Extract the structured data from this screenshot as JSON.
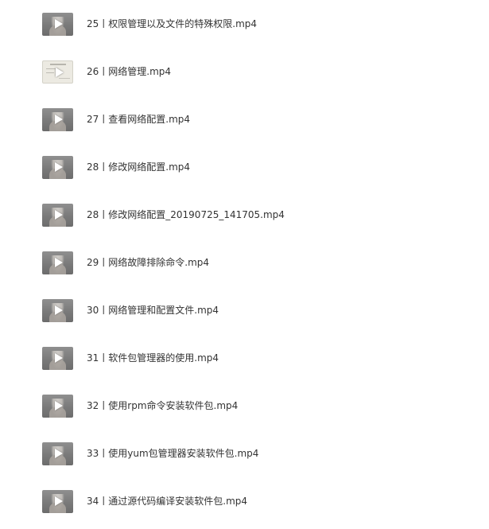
{
  "file_list": {
    "items": [
      {
        "name": "25丨权限管理以及文件的特殊权限.mp4",
        "thumbnail": "video-thumbnail-person"
      },
      {
        "name": "26丨网络管理.mp4",
        "thumbnail": "video-thumbnail-screen"
      },
      {
        "name": "27丨查看网络配置.mp4",
        "thumbnail": "video-thumbnail-person"
      },
      {
        "name": "28丨修改网络配置.mp4",
        "thumbnail": "video-thumbnail-person"
      },
      {
        "name": "28丨修改网络配置_20190725_141705.mp4",
        "thumbnail": "video-thumbnail-person"
      },
      {
        "name": "29丨网络故障排除命令.mp4",
        "thumbnail": "video-thumbnail-person"
      },
      {
        "name": "30丨网络管理和配置文件.mp4",
        "thumbnail": "video-thumbnail-person"
      },
      {
        "name": "31丨软件包管理器的使用.mp4",
        "thumbnail": "video-thumbnail-person"
      },
      {
        "name": "32丨使用rpm命令安装软件包.mp4",
        "thumbnail": "video-thumbnail-person"
      },
      {
        "name": "33丨使用yum包管理器安装软件包.mp4",
        "thumbnail": "video-thumbnail-person"
      },
      {
        "name": "34丨通过源代码编译安装软件包.mp4",
        "thumbnail": "video-thumbnail-person"
      }
    ]
  },
  "icons": {
    "play": "play-icon"
  }
}
